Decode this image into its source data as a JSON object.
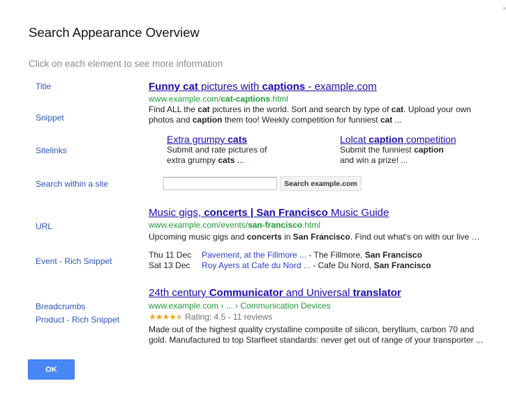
{
  "dialog": {
    "title": "Search Appearance Overview",
    "subtitle": "Click on each element to see more information",
    "close_glyph": "×",
    "ok_label": "OK"
  },
  "labels": {
    "title": "Title",
    "snippet": "Snippet",
    "sitelinks": "Sitelinks",
    "search_within": "Search within a site",
    "url": "URL",
    "event": "Event - Rich Snippet",
    "breadcrumbs": "Breadcrumbs",
    "product": "Product - Rich Snippet"
  },
  "result1": {
    "title_parts": [
      "Funny cat",
      " pictures with ",
      "captions",
      " - example.com"
    ],
    "url_parts": [
      "www.example.com/",
      "cat-captions",
      ".html"
    ],
    "snippet_line1_parts": [
      "Find ALL the ",
      "cat",
      " pictures in the world. Sort and search by type of ",
      "cat",
      ". Upload your own"
    ],
    "snippet_line2_parts": [
      "photos and ",
      "caption",
      " them too! Weekly competition for funniest ",
      "cat",
      " ..."
    ],
    "sitelinks": [
      {
        "title_parts": [
          "Extra grumpy ",
          "cats"
        ],
        "desc_line1": "Submit and rate pictures of",
        "desc_line2_parts": [
          "extra grumpy ",
          "cats",
          " ..."
        ]
      },
      {
        "title_parts": [
          "Lolcat ",
          "caption",
          " competition"
        ],
        "desc_line1_parts": [
          "Submit the funniest ",
          "caption"
        ],
        "desc_line2": "and win a prize! ..."
      }
    ],
    "site_search": {
      "value": "",
      "placeholder": "",
      "button_label": "Search example.com"
    }
  },
  "result2": {
    "title_parts": [
      "Music gigs, ",
      "concerts | San Francisco",
      " Music Guide"
    ],
    "url_parts": [
      "www.example.com/events/",
      "san-francisco",
      ".html"
    ],
    "snippet_parts": [
      "Upcoming music gigs and ",
      "concerts",
      " in ",
      "San Francisco",
      ". Find out what's on with our live …"
    ],
    "events": [
      {
        "date": "Thu 11 Dec",
        "link": "Pavement, at the Fillmore ...",
        "venue": " - The Fillmore, ",
        "city": "San Francisco"
      },
      {
        "date": "Sat 13 Dec",
        "link": "Roy Ayers at Cafe du Nord ...",
        "venue": " - Cafe Du Nord, ",
        "city": "San Francisco"
      }
    ]
  },
  "result3": {
    "title_parts": [
      "24th century ",
      "Communicator",
      " and Universal ",
      "translator"
    ],
    "breadcrumb": "www.example.com › ... › Communication Devices",
    "rating": {
      "value": 4.5,
      "max": 5,
      "stars_full": "★★★★",
      "star_half": "★",
      "text": "Rating: 4.5 - 11 reviews"
    },
    "snippet_line1": "Made out of the highest quality crystalline composite of silicon, beryllium, carbon 70 and",
    "snippet_line2": "gold. Manufactured to top Starfleet standards: never get out of range of your transporter ..."
  },
  "colors": {
    "link": "#1a0dab",
    "label": "#2a55b8",
    "url_green": "#1e9a38",
    "star": "#f2a31b",
    "ok_button": "#4a87f6"
  }
}
